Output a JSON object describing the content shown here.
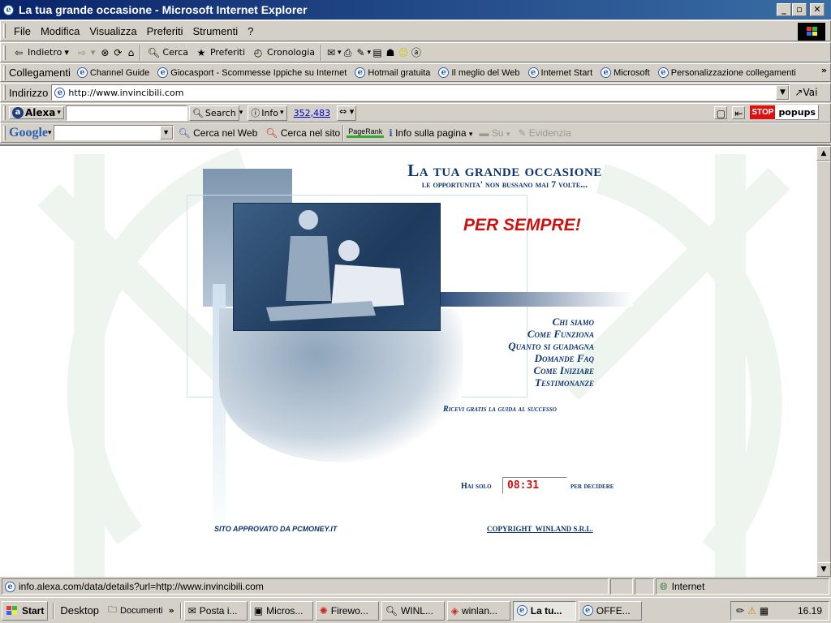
{
  "window": {
    "title": "La tua grande occasione - Microsoft Internet Explorer",
    "min": "_",
    "max": "▫",
    "close": "✕"
  },
  "menu": [
    "File",
    "Modifica",
    "Visualizza",
    "Preferiti",
    "Strumenti",
    "?"
  ],
  "toolbar": {
    "back": "Indietro",
    "search": "Cerca",
    "favorites": "Preferiti",
    "history": "Cronologia"
  },
  "links": {
    "label": "Collegamenti",
    "items": [
      "Channel Guide",
      "Giocasport - Scommesse Ippiche su Internet",
      "Hotmail gratuita",
      "Il meglio del Web",
      "Internet Start",
      "Microsoft",
      "Personalizzazione collegamenti"
    ],
    "more": "»"
  },
  "address": {
    "label": "Indirizzo",
    "value": "http://www.invincibili.com",
    "go": "Vai"
  },
  "alexa": {
    "brand": "Alexa",
    "search": "Search",
    "info": "Info",
    "rank": "352,483",
    "stop": "STOP",
    "popups": "popups"
  },
  "google": {
    "brand": "Google",
    "search_web": "Cerca nel Web",
    "search_site": "Cerca nel sito",
    "pagerank": "PageRank",
    "page_info": "Info sulla pagina",
    "up": "Su",
    "highlight": "Evidenzia"
  },
  "content": {
    "title": "La tua grande occasione",
    "subtitle": "le opportunita' non bussano mai 7 volte...",
    "forever": "PER SEMPRE!",
    "nav": [
      "Chi siamo",
      "Come Funziona",
      "Quanto si guadagna",
      "Domande Faq",
      "Come Iniziare",
      "Testimonanze"
    ],
    "guide": "Ricevi gratis la guida al successo",
    "hai_solo": "Hai solo",
    "timer": "08:31",
    "per_decidere": "per decidere",
    "approved": "sito approvato da PCMONEY.IT",
    "copyright": "COPYRIGHT  WINLAND S.R.L."
  },
  "status": {
    "text": "info.alexa.com/data/details?url=http://www.invincibili.com",
    "zone": "Internet"
  },
  "taskbar": {
    "start": "Start",
    "desktop": "Desktop",
    "documents": "Documenti",
    "more": "»",
    "buttons": [
      "Posta i...",
      "Micros...",
      "Firewo...",
      "WINL...",
      "winlan...",
      "La tu...",
      "OFFE..."
    ],
    "clock": "16.19"
  },
  "colors": {
    "titlebar": "#0a246a",
    "accent_red": "#cc1111",
    "link_blue": "#0b3470"
  }
}
